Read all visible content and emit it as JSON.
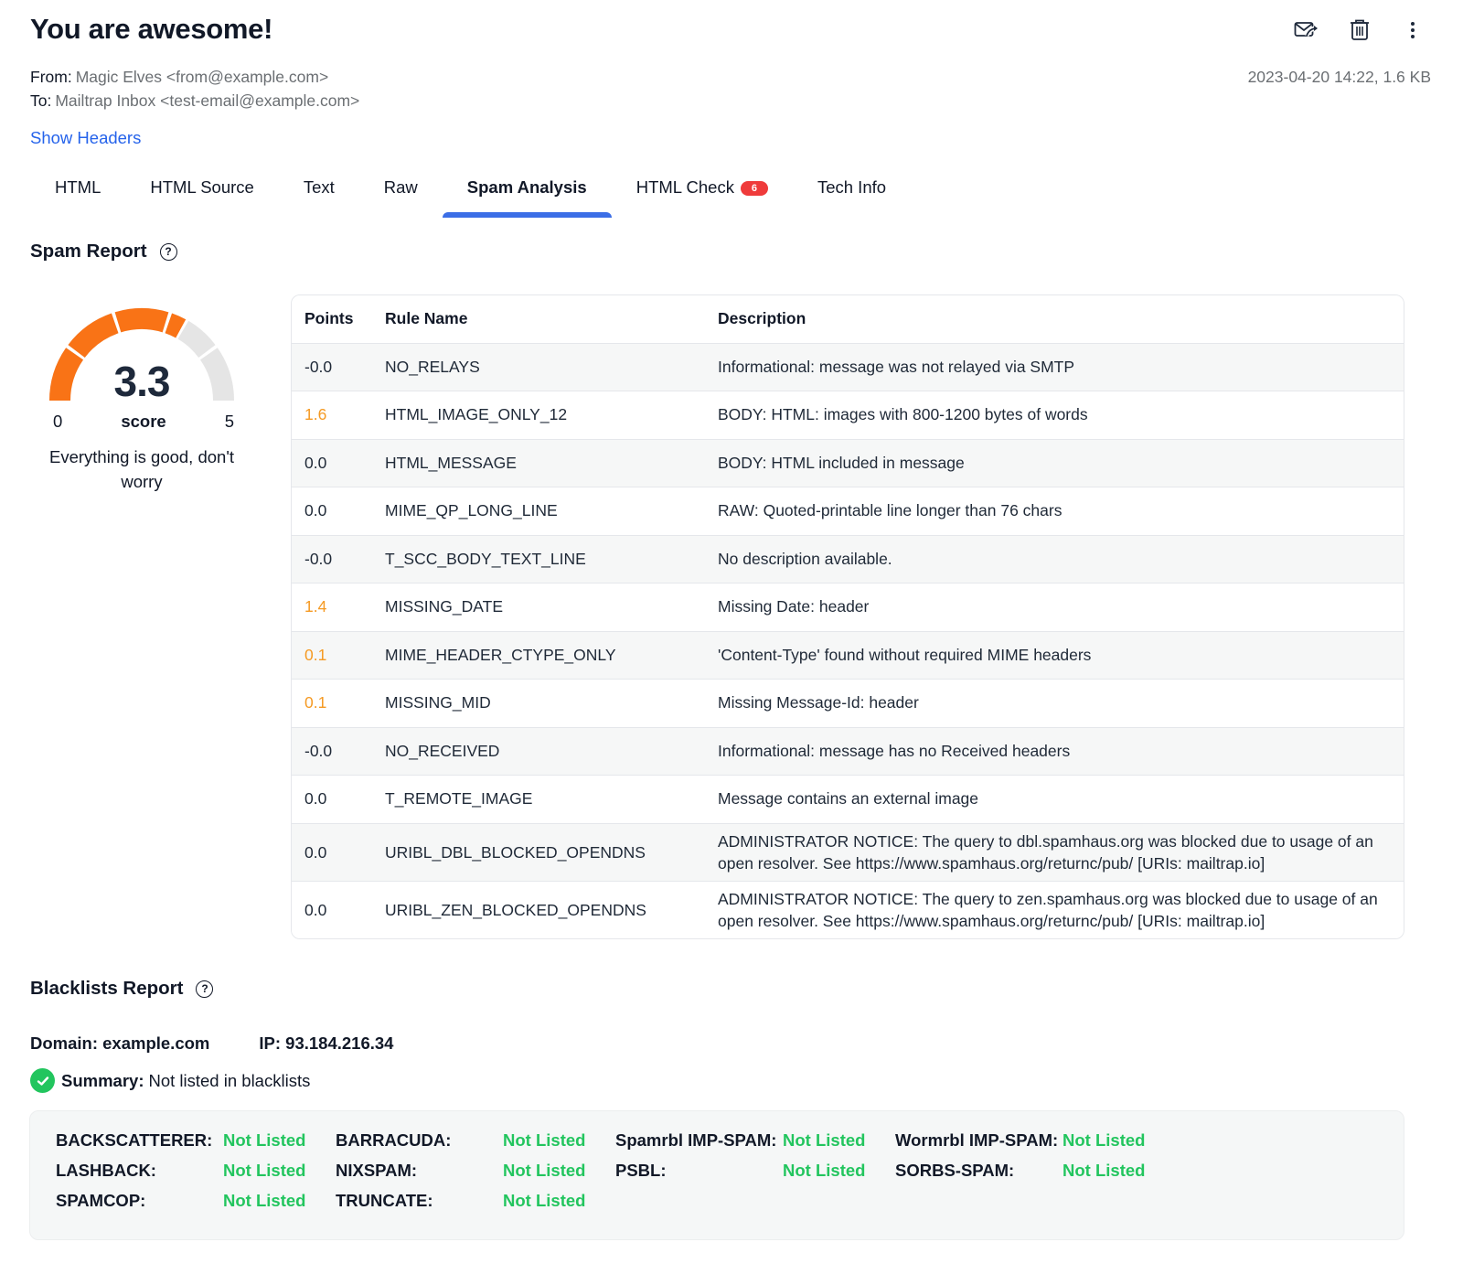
{
  "email": {
    "subject": "You are awesome!",
    "from_label": "From:",
    "from_value": "Magic Elves <from@example.com>",
    "to_label": "To:",
    "to_value": "Mailtrap Inbox <test-email@example.com>",
    "date_size": "2023-04-20 14:22, 1.6 KB",
    "show_headers": "Show Headers"
  },
  "actions": {
    "forward_icon": "mail-forward-icon",
    "delete_icon": "trash-icon",
    "more_icon": "more-vertical-icon"
  },
  "tabs": [
    {
      "label": "HTML",
      "active": false
    },
    {
      "label": "HTML Source",
      "active": false
    },
    {
      "label": "Text",
      "active": false
    },
    {
      "label": "Raw",
      "active": false
    },
    {
      "label": "Spam Analysis",
      "active": true
    },
    {
      "label": "HTML Check",
      "active": false,
      "badge": "6"
    },
    {
      "label": "Tech Info",
      "active": false
    }
  ],
  "spam_report": {
    "title": "Spam Report",
    "help_icon": "?",
    "gauge": {
      "score": "3.3",
      "score_value": 3.3,
      "min": "0",
      "max": "5",
      "min_value": 0,
      "max_value": 5,
      "label": "score",
      "message": "Everything is good, don't worry",
      "fill_color": "#f97316",
      "track_color": "#e5e5e5"
    },
    "columns": [
      "Points",
      "Rule Name",
      "Description"
    ],
    "rows": [
      {
        "points": "-0.0",
        "rule": "NO_RELAYS",
        "description": "Informational: message was not relayed via SMTP",
        "warn": false
      },
      {
        "points": "1.6",
        "rule": "HTML_IMAGE_ONLY_12",
        "description": "BODY: HTML: images with 800-1200 bytes of words",
        "warn": true
      },
      {
        "points": "0.0",
        "rule": "HTML_MESSAGE",
        "description": "BODY: HTML included in message",
        "warn": false
      },
      {
        "points": "0.0",
        "rule": "MIME_QP_LONG_LINE",
        "description": "RAW: Quoted-printable line longer than 76 chars",
        "warn": false
      },
      {
        "points": "-0.0",
        "rule": "T_SCC_BODY_TEXT_LINE",
        "description": "No description available.",
        "warn": false
      },
      {
        "points": "1.4",
        "rule": "MISSING_DATE",
        "description": "Missing Date: header",
        "warn": true
      },
      {
        "points": "0.1",
        "rule": "MIME_HEADER_CTYPE_ONLY",
        "description": "'Content-Type' found without required MIME headers",
        "warn": true
      },
      {
        "points": "0.1",
        "rule": "MISSING_MID",
        "description": "Missing Message-Id: header",
        "warn": true
      },
      {
        "points": "-0.0",
        "rule": "NO_RECEIVED",
        "description": "Informational: message has no Received headers",
        "warn": false
      },
      {
        "points": "0.0",
        "rule": "T_REMOTE_IMAGE",
        "description": "Message contains an external image",
        "warn": false
      },
      {
        "points": "0.0",
        "rule": "URIBL_DBL_BLOCKED_OPENDNS",
        "description": "ADMINISTRATOR NOTICE: The query to dbl.spamhaus.org was blocked due to usage of an open resolver. See https://www.spamhaus.org/returnc/pub/ [URIs: mailtrap.io]",
        "warn": false
      },
      {
        "points": "0.0",
        "rule": "URIBL_ZEN_BLOCKED_OPENDNS",
        "description": "ADMINISTRATOR NOTICE: The query to zen.spamhaus.org was blocked due to usage of an open resolver. See https://www.spamhaus.org/returnc/pub/ [URIs: mailtrap.io]",
        "warn": false
      }
    ],
    "warn_color": "#f59a23"
  },
  "blacklists": {
    "title": "Blacklists Report",
    "domain": "Domain: example.com",
    "ip": "IP: 93.184.216.34",
    "summary_label": "Summary:",
    "summary_value": "Not listed in blacklists",
    "status_color": "#22c55e",
    "entries": [
      {
        "name": "BACKSCATTERER:",
        "status": "Not Listed"
      },
      {
        "name": "BARRACUDA:",
        "status": "Not Listed"
      },
      {
        "name": "Spamrbl IMP-SPAM:",
        "status": "Not Listed"
      },
      {
        "name": "Wormrbl IMP-SPAM:",
        "status": "Not Listed"
      },
      {
        "name": "LASHBACK:",
        "status": "Not Listed"
      },
      {
        "name": "NIXSPAM:",
        "status": "Not Listed"
      },
      {
        "name": "PSBL:",
        "status": "Not Listed"
      },
      {
        "name": "SORBS-SPAM:",
        "status": "Not Listed"
      },
      {
        "name": "SPAMCOP:",
        "status": "Not Listed"
      },
      {
        "name": "TRUNCATE:",
        "status": "Not Listed"
      }
    ]
  }
}
